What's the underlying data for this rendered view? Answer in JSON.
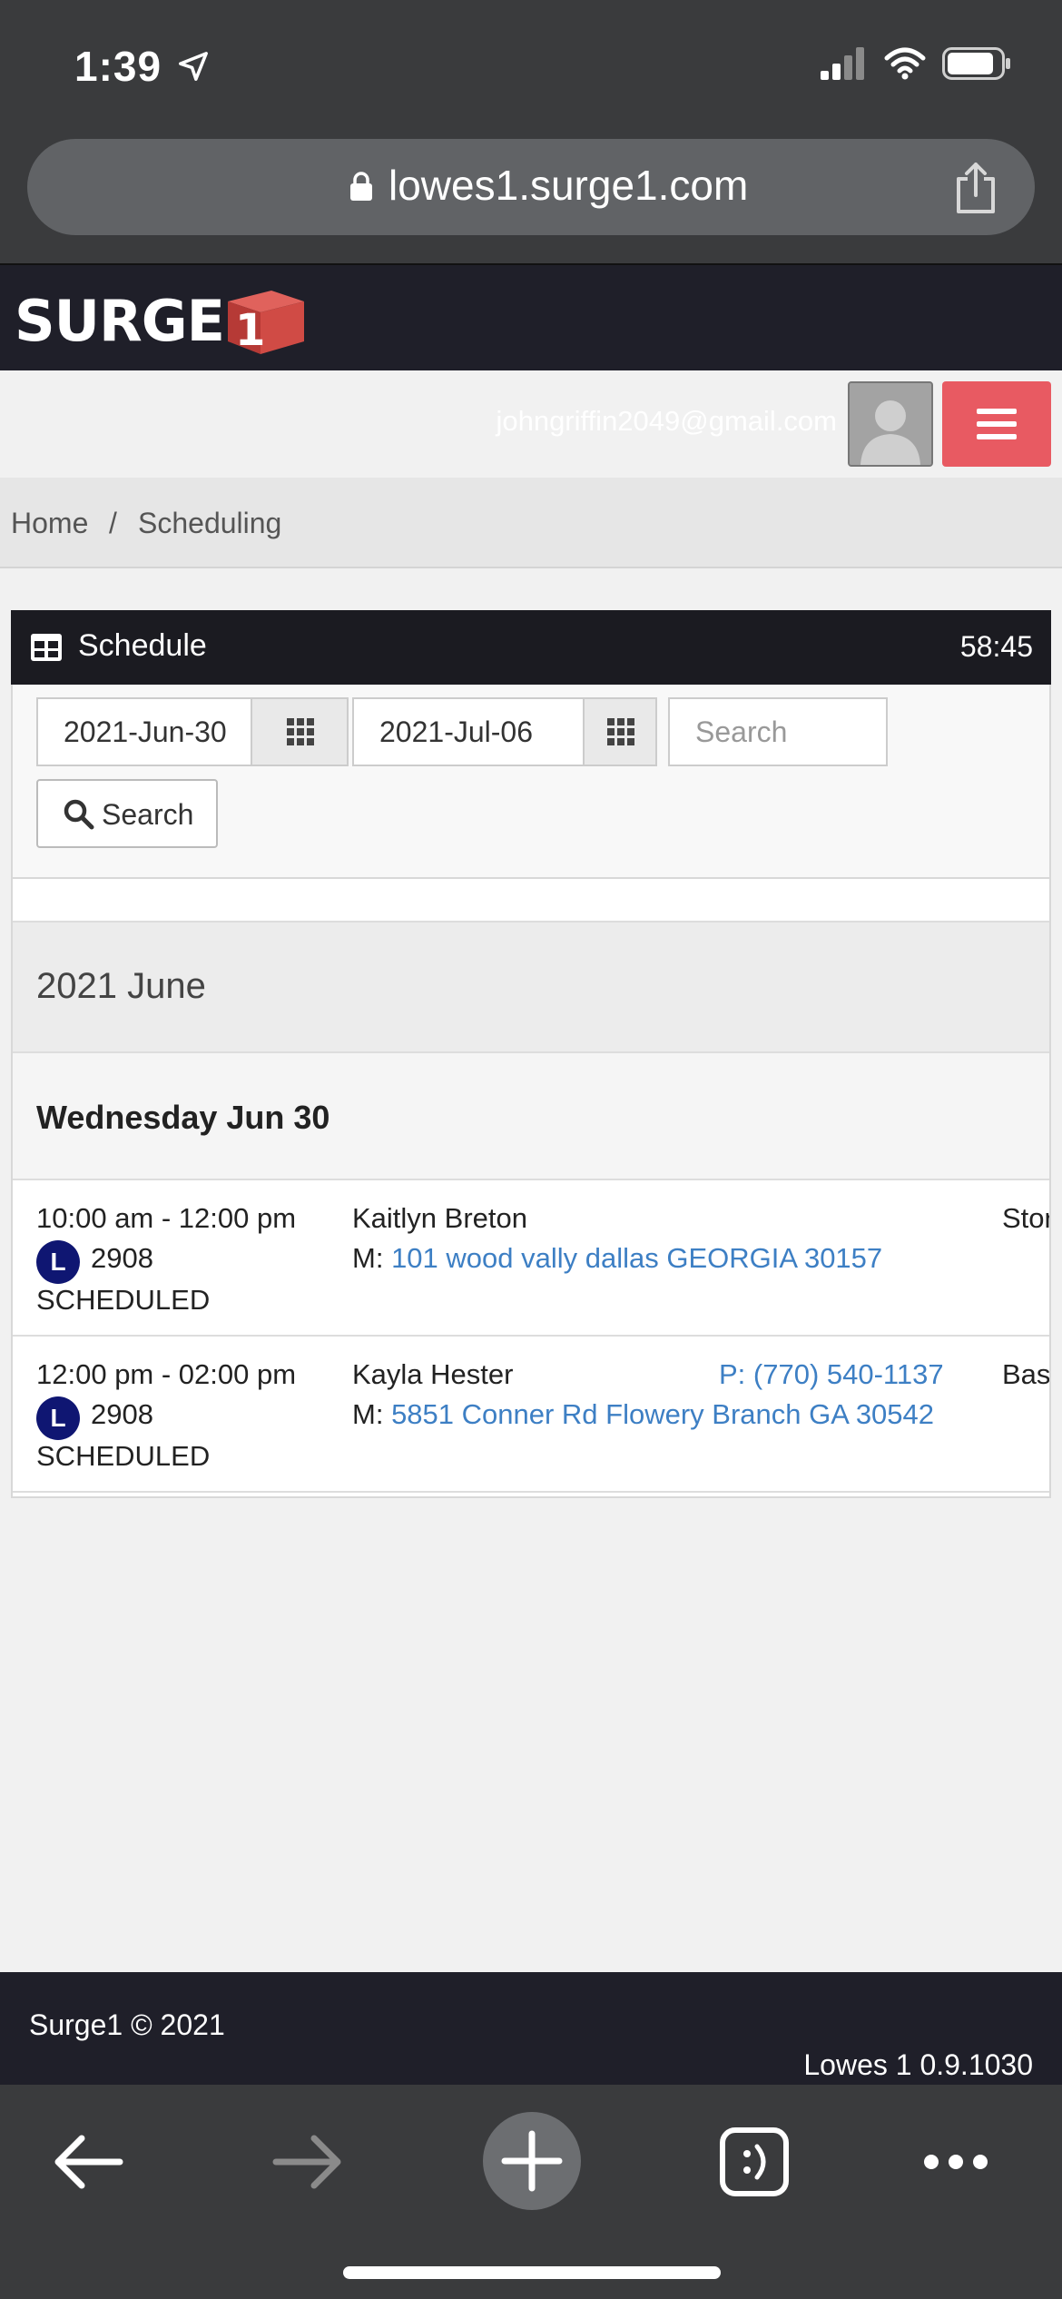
{
  "status_bar": {
    "time": "1:39"
  },
  "browser": {
    "url": "lowes1.surge1.com"
  },
  "site": {
    "logo_text": "SURGE",
    "logo_mark": "1",
    "user_email": "johngriffin2049@gmail.com"
  },
  "breadcrumb": {
    "home": "Home",
    "separator": "/",
    "current": "Scheduling"
  },
  "schedule": {
    "title": "Schedule",
    "timer": "58:45",
    "start_date": "2021-Jun-30",
    "end_date": "2021-Jul-06",
    "search_placeholder": "Search",
    "search_button": "Search",
    "month_label": "2021 June",
    "day_label": "Wednesday Jun 30",
    "appointments": [
      {
        "time": "10:00 am - 12:00 pm",
        "badge": "L",
        "store": "2908",
        "status": "SCHEDULED",
        "name": "Kaitlyn Breton",
        "addr_prefix": "M: ",
        "address": "101 wood vally  dallas GEORGIA 30157",
        "phone": "",
        "extra": "Stor"
      },
      {
        "time": "12:00 pm - 02:00 pm",
        "badge": "L",
        "store": "2908",
        "status": "SCHEDULED",
        "name": "Kayla Hester",
        "addr_prefix": "M: ",
        "address": "5851 Conner Rd  Flowery Branch GA 30542",
        "phone": "P: (770) 540-1137",
        "extra": "Bas"
      }
    ]
  },
  "footer": {
    "copyright": "Surge1 © 2021",
    "version": "Lowes 1 0.9.1030"
  },
  "colors": {
    "accent_red": "#e85a62",
    "link_blue": "#3d7fc4",
    "badge_navy": "#0f1672",
    "header_dark": "#1f1f29"
  }
}
